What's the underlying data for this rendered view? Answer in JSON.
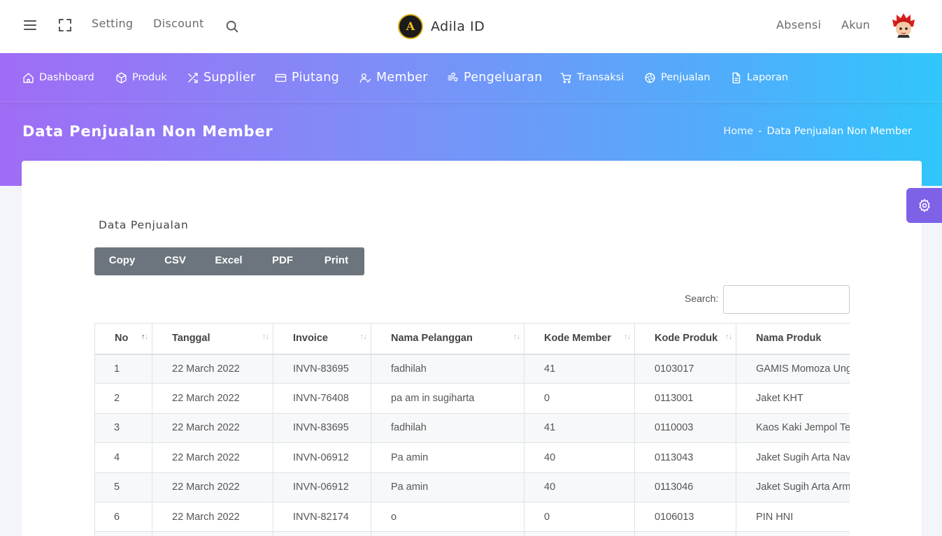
{
  "topbar": {
    "setting": "Setting",
    "discount": "Discount",
    "brand": "Adila ID",
    "absensi": "Absensi",
    "akun": "Akun"
  },
  "nav": {
    "dashboard": "Dashboard",
    "produk": "Produk",
    "supplier": "Supplier",
    "piutang": "Piutang",
    "member": "Member",
    "pengeluaran": "Pengeluaran",
    "transaksi": "Transaksi",
    "penjualan": "Penjualan",
    "laporan": "Laporan"
  },
  "page": {
    "title": "Data Penjualan Non Member",
    "breadcrumb_home": "Home",
    "breadcrumb_sep": "-",
    "breadcrumb_current": "Data Penjualan Non Member"
  },
  "card": {
    "title": "Data Penjualan",
    "buttons": [
      "Copy",
      "CSV",
      "Excel",
      "PDF",
      "Print"
    ],
    "search_label": "Search:"
  },
  "table": {
    "headers": [
      "No",
      "Tanggal",
      "Invoice",
      "Nama Pelanggan",
      "Kode Member",
      "Kode Produk",
      "Nama Produk"
    ],
    "rows": [
      [
        "1",
        "22 March 2022",
        "INVN-83695",
        "fadhilah",
        "41",
        "0103017",
        "GAMIS Momoza Ungu"
      ],
      [
        "2",
        "22 March 2022",
        "INVN-76408",
        "pa am in sugiharta",
        "0",
        "0113001",
        "Jaket KHT"
      ],
      [
        "3",
        "22 March 2022",
        "INVN-83695",
        "fadhilah",
        "41",
        "0110003",
        "Kaos Kaki Jempol Tebal"
      ],
      [
        "4",
        "22 March 2022",
        "INVN-06912",
        "Pa amin",
        "40",
        "0113043",
        "Jaket Sugih Arta Navy"
      ],
      [
        "5",
        "22 March 2022",
        "INVN-06912",
        "Pa amin",
        "40",
        "0113046",
        "Jaket Sugih Arta Army"
      ],
      [
        "6",
        "22 March 2022",
        "INVN-82174",
        "o",
        "0",
        "0106013",
        "PIN HNI"
      ]
    ]
  },
  "colors": {
    "nav_gradient_start": "#a06cf5",
    "nav_gradient_end": "#31c6fb",
    "button_group": "#6c757d",
    "settings_fab": "#7d62e8"
  }
}
